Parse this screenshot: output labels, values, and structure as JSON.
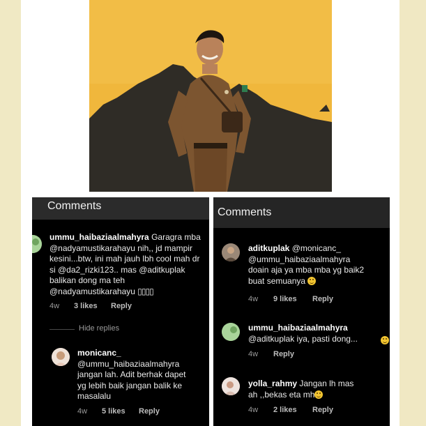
{
  "panels": {
    "left": {
      "title": "Comments",
      "comment1": {
        "username": "ummu_haibaziaalmahyra",
        "text": "Garagra mba @nadyamustikarahayu nih,, jd mampir kesini...btw, ini mah jauh lbh cool mah dr si @da2_rizki123.. mas @aditkuplak balikan dong ma teh @nadyamustikarahayu",
        "emoji_glyphs": "▯▯▯▯",
        "age": "4w",
        "likes": "3 likes",
        "reply": "Reply"
      },
      "hide_replies": "Hide replies",
      "comment2": {
        "username": "monicanc_",
        "text_lines": [
          "@ummu_haibaziaalmahyra",
          "jangan lah. Adit berhak dapet",
          "yg lebih baik jangan balik ke",
          "masalalu"
        ],
        "age": "4w",
        "likes": "5 likes",
        "reply": "Reply"
      }
    },
    "right": {
      "title": "Comments",
      "comment1": {
        "username": "aditkuplak",
        "line1_rest": " @monicanc_",
        "lines": [
          "@ummu_haibaziaalmahyra",
          "doain aja ya mba mba yg baik2",
          "buat semuanya"
        ],
        "age": "4w",
        "likes": "9 likes",
        "reply": "Reply"
      },
      "comment2": {
        "username": "ummu_haibaziaalmahyra",
        "line2": "@aditkuplak iya, pasti dong...",
        "age": "4w",
        "reply": "Reply"
      },
      "comment3": {
        "username": "yolla_rahmy",
        "line1_rest": " Jangan lh mas",
        "line2": "ah ,,bekas eta mh",
        "age": "4w",
        "likes": "2 likes",
        "reply": "Reply"
      }
    }
  },
  "colors": {
    "panel_bg": "#000000",
    "header_bg": "#2b2b2b",
    "photo_wall": "#efb63a",
    "uniform": "#8a5a2b"
  },
  "icons": {
    "emoji": "smiling-face-emoji",
    "avatars": [
      "avatar-ummu",
      "avatar-monicanc",
      "avatar-aditkuplak",
      "avatar-ummu",
      "avatar-yolla"
    ]
  }
}
